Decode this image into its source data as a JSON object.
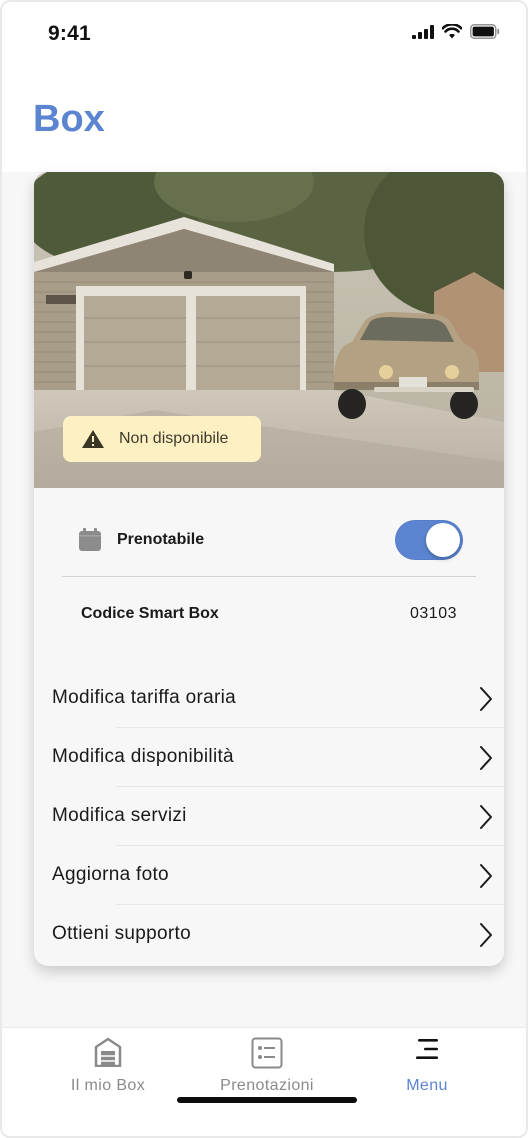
{
  "status_bar": {
    "time": "9:41"
  },
  "header": {
    "title": "Box"
  },
  "card": {
    "badge": {
      "label": "Non disponibile",
      "icon": "warning-icon"
    },
    "bookable": {
      "label": "Prenotabile",
      "icon": "calendar-icon",
      "enabled": true
    },
    "smart_box": {
      "label": "Codice Smart Box",
      "value": "03103"
    },
    "menu_items": [
      {
        "label": "Modifica tariffa oraria"
      },
      {
        "label": "Modifica disponibilità"
      },
      {
        "label": "Modifica servizi"
      },
      {
        "label": "Aggiorna foto"
      },
      {
        "label": "Ottieni supporto"
      }
    ]
  },
  "tab_bar": {
    "tabs": [
      {
        "label": "Il mio Box",
        "icon": "garage-icon",
        "active": false
      },
      {
        "label": "Prenotazioni",
        "icon": "list-icon",
        "active": false
      },
      {
        "label": "Menu",
        "icon": "menu-icon",
        "active": true
      }
    ]
  },
  "colors": {
    "accent": "#5b84d1",
    "badge_background": "#fdf1c4",
    "text": "#1a1a1a",
    "inactive_tab": "#8a8a8a"
  }
}
